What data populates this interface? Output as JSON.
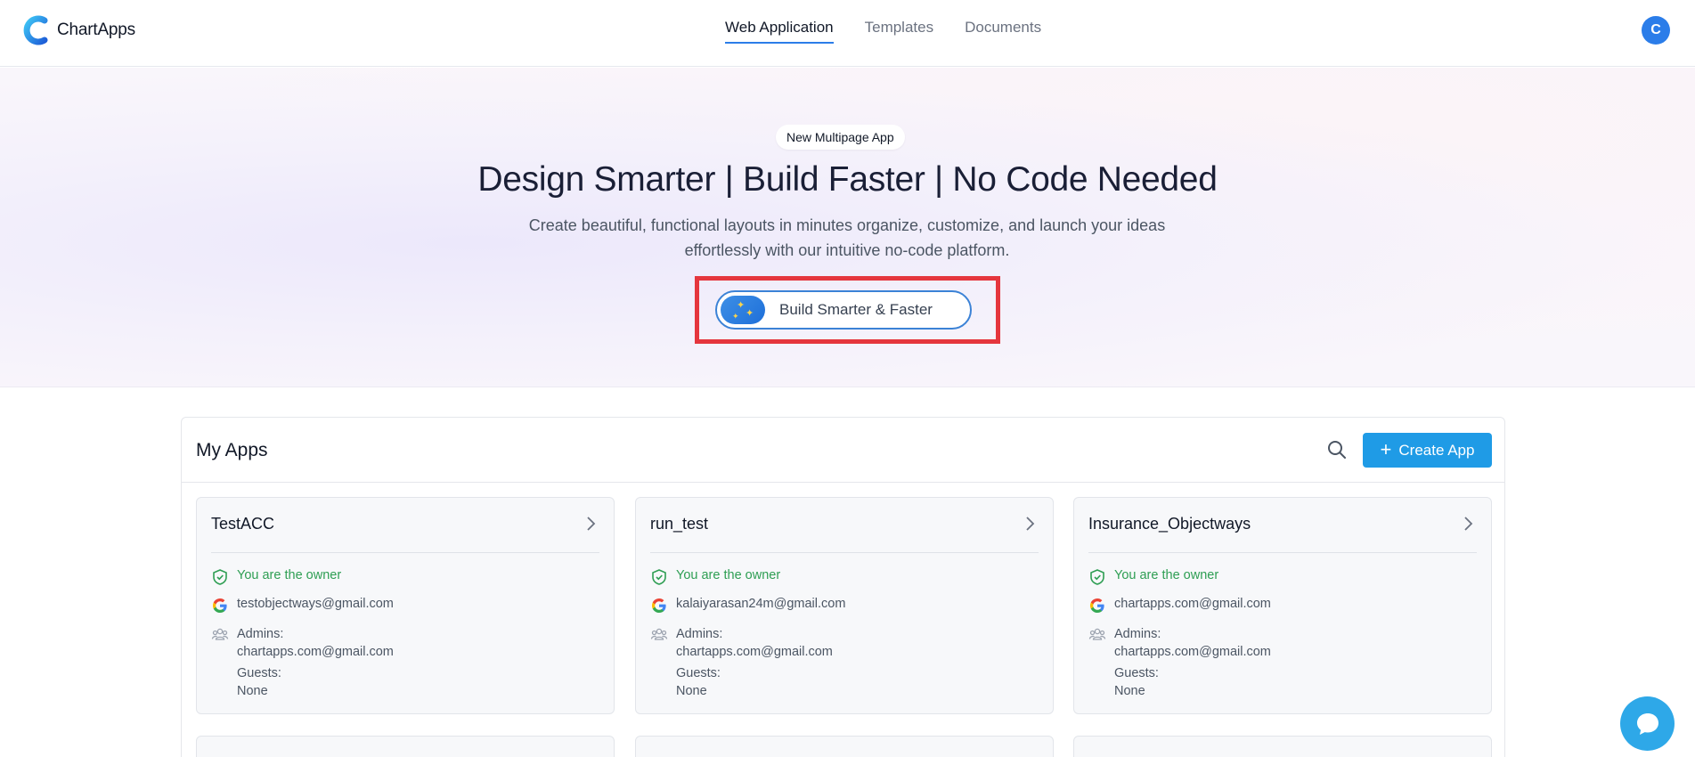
{
  "header": {
    "brand_name": "ChartApps",
    "nav": [
      {
        "label": "Web Application",
        "active": true
      },
      {
        "label": "Templates",
        "active": false
      },
      {
        "label": "Documents",
        "active": false
      }
    ],
    "avatar_initial": "C"
  },
  "hero": {
    "pill": "New Multipage App",
    "title": "Design Smarter | Build Faster | No Code Needed",
    "subtitle_line1": "Create beautiful, functional layouts in minutes organize, customize, and launch your ideas",
    "subtitle_line2": "effortlessly with our intuitive no-code platform.",
    "cta_label": "Build Smarter & Faster"
  },
  "apps": {
    "title": "My Apps",
    "create_label": "Create App",
    "cards": [
      {
        "name": "TestACC",
        "owner_text": "You are the owner",
        "email": "testobjectways@gmail.com",
        "admins_label": "Admins:",
        "admins_value": "chartapps.com@gmail.com",
        "guests_label": "Guests:",
        "guests_value": "None"
      },
      {
        "name": "run_test",
        "owner_text": "You are the owner",
        "email": "kalaiyarasan24m@gmail.com",
        "admins_label": "Admins:",
        "admins_value": "chartapps.com@gmail.com",
        "guests_label": "Guests:",
        "guests_value": "None"
      },
      {
        "name": "Insurance_Objectways",
        "owner_text": "You are the owner",
        "email": "chartapps.com@gmail.com",
        "admins_label": "Admins:",
        "admins_value": "chartapps.com@gmail.com",
        "guests_label": "Guests:",
        "guests_value": "None"
      }
    ]
  },
  "colors": {
    "accent": "#2b7de9",
    "create_button": "#1f9be6",
    "owner_green": "#2e9e53",
    "highlight_red": "#e5363d",
    "chat_bubble": "#2ea8e8"
  },
  "icons": [
    "brand-logo",
    "sparkle-icon",
    "search-icon",
    "plus-icon",
    "chevron-right-icon",
    "shield-check-icon",
    "google-icon",
    "admins-group-icon",
    "chat-icon"
  ]
}
